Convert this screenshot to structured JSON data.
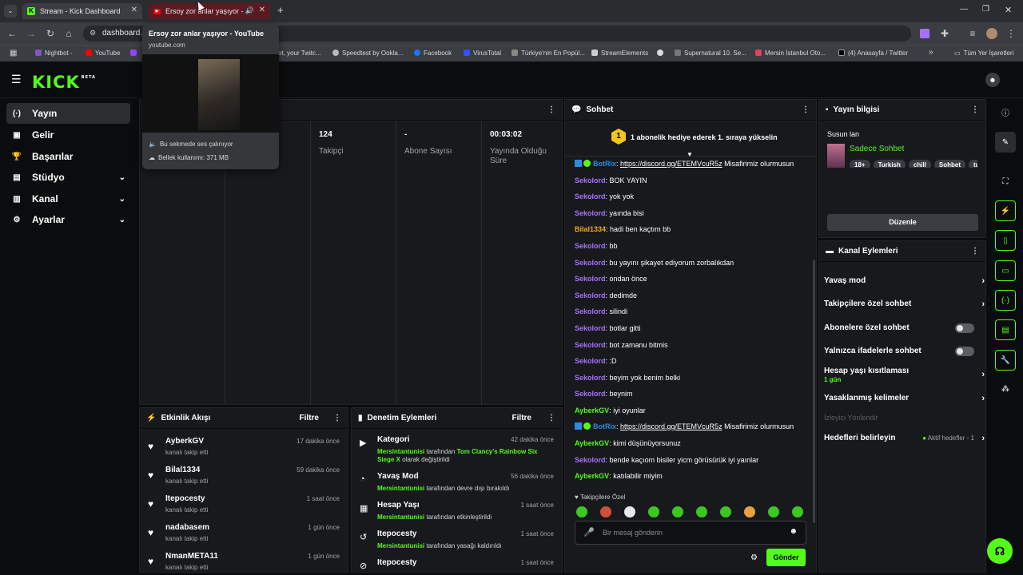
{
  "browser": {
    "tabs": [
      {
        "title": "Stream - Kick Dashboard",
        "icon": "kick-favicon"
      },
      {
        "title": "Ersoy zor anlar yaşıyor - YouTube",
        "icon": "youtube-favicon"
      }
    ],
    "new_tab": "+",
    "url": "dashboard.k",
    "bookmarks": [
      "Nightbot -",
      "YouTube",
      "ot, your Twitc...",
      "Speedtest by Ookla...",
      "Facebook",
      "VirusTotal",
      "Türkiye'nin En Popül...",
      "StreamElements",
      "Supernatural 10. Se...",
      "Mersin İstanbul Oto...",
      "(4) Anasayfa / Twitter"
    ],
    "bookmarks_more": "»",
    "all_bookmarks": "Tüm Yer İşaretleri",
    "tooltip": {
      "title": "Ersoy zor anlar yaşıyor - YouTube",
      "domain": "youtube.com",
      "audio": "Bu sekmede ses çalınıyor",
      "memory": "Bellek kullanımı: 371 MB"
    }
  },
  "kick": {
    "logo": "KICK",
    "logo_badge": "BETA",
    "sidebar": [
      {
        "label": "Yayın",
        "icon": "broadcast-icon",
        "active": true,
        "chevron": false
      },
      {
        "label": "Gelir",
        "icon": "money-icon",
        "active": false,
        "chevron": false
      },
      {
        "label": "Başarılar",
        "icon": "trophy-icon",
        "active": false,
        "chevron": false
      },
      {
        "label": "Stüdyo",
        "icon": "studio-icon",
        "active": false,
        "chevron": true
      },
      {
        "label": "Kanal",
        "icon": "channel-icon",
        "active": false,
        "chevron": true
      },
      {
        "label": "Ayarlar",
        "icon": "settings-icon",
        "active": false,
        "chevron": true
      }
    ],
    "stats": [
      {
        "value": "124",
        "label": "Takipçi"
      },
      {
        "value": "-",
        "label": "Abone Sayısı"
      },
      {
        "value": "00:03:02",
        "label": "Yayında Olduğu Süre"
      }
    ],
    "events": {
      "title": "Etkinlik Akışı",
      "filter": "Filtre",
      "items": [
        {
          "name": "AyberkGV",
          "sub": "kanalı takip etti",
          "time": "17 dakika önce"
        },
        {
          "name": "Bilal1334",
          "sub": "kanalı takip etti",
          "time": "59 dakika önce"
        },
        {
          "name": "Itepocesty",
          "sub": "kanalı takip etti",
          "time": "1 saat önce"
        },
        {
          "name": "nadabasem",
          "sub": "kanalı takip etti",
          "time": "1 gün önce"
        },
        {
          "name": "NmanMETA11",
          "sub": "kanalı takip etti",
          "time": "1 gün önce"
        }
      ]
    },
    "moderation": {
      "title": "Denetim Eylemleri",
      "filter": "Filtre",
      "items": [
        {
          "name": "Kategori",
          "user": "Mersintantunisi",
          "mid": " tarafından ",
          "target": "Tom Clancy's Rainbow Six Siege X",
          "rest": " olarak değiştirildi",
          "time": "42 dakika önce",
          "icon": "category-icon"
        },
        {
          "name": "Yavaş Mod",
          "user": "Mersintantunisi",
          "mid": " tarafından devre dışı bırakıldı",
          "target": "",
          "rest": "",
          "time": "56 dakika önce",
          "icon": "slow-mode-icon"
        },
        {
          "name": "Hesap Yaşı",
          "user": "Mersintantunisi",
          "mid": " tarafından etkinleştirildi",
          "target": "",
          "rest": "",
          "time": "1 saat önce",
          "icon": "calendar-icon"
        },
        {
          "name": "Itepocesty",
          "user": "Mersintantunisi",
          "mid": " tarafından yasağı kaldırıldı",
          "target": "",
          "rest": "",
          "time": "1 saat önce",
          "icon": "unban-icon"
        },
        {
          "name": "Itepocesty",
          "user": "",
          "mid": "",
          "target": "",
          "rest": "",
          "time": "1 saat önce",
          "icon": "ban-icon"
        }
      ]
    },
    "chat": {
      "title": "Sohbet",
      "pinned_rank": "1",
      "pinned": "1 abonelik hediye ederek 1. sıraya yükselin",
      "messages": [
        {
          "user": "BotRix",
          "color": "#2b8ae6",
          "text": "",
          "link": "https://discord.gg/ETEMVcuR5z",
          "after": " Misafirimiz olurmusun",
          "bot": true
        },
        {
          "user": "Sekolord",
          "color": "#a970ff",
          "text": "BOK YAYIN"
        },
        {
          "user": "Sekolord",
          "color": "#a970ff",
          "text": "yok yok"
        },
        {
          "user": "Sekolord",
          "color": "#a970ff",
          "text": "yaında bisi"
        },
        {
          "user": "Bilal1334",
          "color": "#f5a623",
          "text": "hadi ben kaçtım bb"
        },
        {
          "user": "Sekolord",
          "color": "#a970ff",
          "text": "bb"
        },
        {
          "user": "Sekolord",
          "color": "#a970ff",
          "text": "bu yayını şikayet ediyorum zorbalıkdan"
        },
        {
          "user": "Sekolord",
          "color": "#a970ff",
          "text": "ondan önce"
        },
        {
          "user": "Sekolord",
          "color": "#a970ff",
          "text": "dedimde"
        },
        {
          "user": "Sekolord",
          "color": "#a970ff",
          "text": "silindi"
        },
        {
          "user": "Sekolord",
          "color": "#a970ff",
          "text": "botlar gitti"
        },
        {
          "user": "Sekolord",
          "color": "#a970ff",
          "text": "bot zamanu bitmis"
        },
        {
          "user": "Sekolord",
          "color": "#a970ff",
          "text": ":D"
        },
        {
          "user": "Sekolord",
          "color": "#a970ff",
          "text": "beyim yok benim belki"
        },
        {
          "user": "Sekolord",
          "color": "#a970ff",
          "text": "beynim"
        },
        {
          "user": "AyberkGV",
          "color": "#53fc18",
          "text": "iyi oyunlar"
        },
        {
          "user": "BotRix",
          "color": "#2b8ae6",
          "text": "",
          "link": "https://discord.gg/ETEMVcuR5z",
          "after": " Misafirimiz olurmusun",
          "bot": true
        },
        {
          "user": "AyberkGV",
          "color": "#53fc18",
          "text": "kimi düşünüyorsunuz"
        },
        {
          "user": "Sekolord",
          "color": "#a970ff",
          "text": "bende kaçıom bisiler yicm görüsürük iyi yaınlar"
        },
        {
          "user": "AyberkGV",
          "color": "#53fc18",
          "text": "katılabilir miyim"
        }
      ],
      "followers_only": "Takipçilere Özel",
      "placeholder": "Bir mesaj gönderin",
      "send": "Gönder"
    },
    "stream_info": {
      "title": "Yayın bilgisi",
      "stream_title": "Susun lan",
      "category": "Sadece Sohbet",
      "tags": [
        "18+",
        "Turkish",
        "chill",
        "Sohbet",
        "tu"
      ],
      "edit": "Düzenle"
    },
    "channel_actions": {
      "title": "Kanal Eylemleri",
      "items": [
        {
          "label": "Yavaş mod",
          "type": "arrow"
        },
        {
          "label": "Takipçilere özel sohbet",
          "type": "arrow"
        },
        {
          "label": "Abonelere özel sohbet",
          "type": "toggle"
        },
        {
          "label": "Yalnızca ifadelerle sohbet",
          "type": "toggle"
        },
        {
          "label": "Hesap yaşı kısıtlaması",
          "sub": "1 gün",
          "type": "arrow"
        },
        {
          "label": "Yasaklanmış kelimeler",
          "type": "arrow"
        },
        {
          "label": "İzleyici Yönlendir",
          "type": "disabled"
        },
        {
          "label": "Hedefleri belirleyin",
          "extra": "Aktif hedefler - 1",
          "type": "arrow"
        }
      ]
    },
    "accent": "#53fc18"
  }
}
